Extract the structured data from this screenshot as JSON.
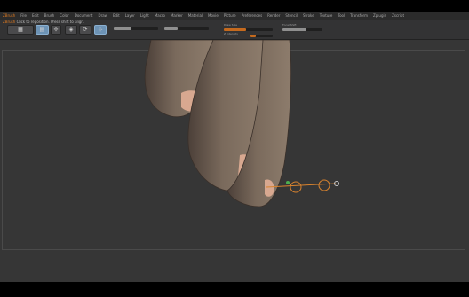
{
  "menu": {
    "app_name": "ZBrush",
    "items": [
      "File",
      "Edit",
      "Brush",
      "Color",
      "Document",
      "Draw",
      "Edit",
      "Layer",
      "Light",
      "Macro",
      "Marker",
      "Material",
      "Movie",
      "Picture",
      "Preferences",
      "Render",
      "Stencil",
      "Stroke",
      "Texture",
      "Tool",
      "Transform",
      "Zplugin",
      "Zscript"
    ]
  },
  "toolbar": {
    "hint_label": "Click to reposition. Press shift to align.",
    "status_prefix": "ZBrush",
    "draw_size_label": "Draw Size",
    "focal_shift_label": "Focal Shift",
    "z_intensity_label": "Z Intensity",
    "draw_size_value": 0.45,
    "z_intensity_value": 0.25,
    "focal_shift_value": 0.6
  },
  "viewport": {
    "background_color": "#363636",
    "model_color": "#7a6a5c",
    "nail_color": "#d8a890",
    "gizmo_color": "#d9832e",
    "gizmo_end_color": "#c8c8c8"
  }
}
